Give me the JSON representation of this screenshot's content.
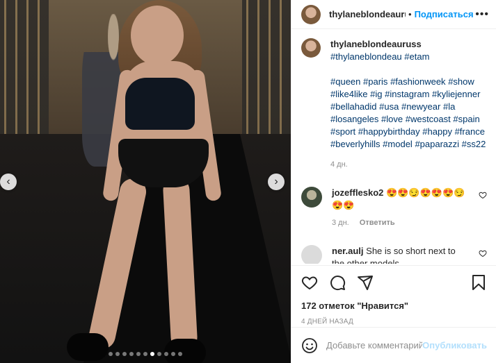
{
  "post": {
    "username": "thylaneblondeauruss",
    "follow_label": "Подписаться",
    "separator": "•",
    "more_label": "•••"
  },
  "caption": {
    "username": "thylaneblondeauruss",
    "line1_tags": [
      "#thylaneblondeau",
      "#etam"
    ],
    "tags": [
      "#queen",
      "#paris",
      "#fashionweek",
      "#show",
      "#like4like",
      "#ig",
      "#instagram",
      "#kyliejenner",
      "#bellahadid",
      "#usa",
      "#newyear",
      "#la",
      "#losangeles",
      "#love",
      "#westcoast",
      "#spain",
      "#sport",
      "#happybirthday",
      "#happy",
      "#france",
      "#beverlyhills",
      "#model",
      "#paparazzi",
      "#ss22"
    ],
    "time": "4 дн."
  },
  "comments": [
    {
      "username": "jozefflesko2",
      "text": "😍😍😏😍😍😍😏😍😍",
      "time": "3 дн.",
      "reply_label": "Ответить"
    },
    {
      "username": "ner.aulj",
      "text": "She is so short next to the other models"
    }
  ],
  "likes": "172 отметок \"Нравится\"",
  "timeago": "4 ДНЕЙ НАЗАД",
  "add_comment": {
    "placeholder": "Добавьте комментарий...",
    "publish_label": "Опубликовать"
  },
  "carousel": {
    "dot_count": 11,
    "active_index": 6
  },
  "icons": {
    "prev": "chevron-left-icon",
    "next": "chevron-right-icon",
    "like": "heart-icon",
    "comment": "comment-icon",
    "share": "share-icon",
    "save": "bookmark-icon",
    "emoji": "emoji-icon"
  },
  "colors": {
    "accent": "#0095f6",
    "hashtag": "#00376b",
    "muted": "#8e8e8e",
    "publish_disabled": "#b2dffc"
  }
}
